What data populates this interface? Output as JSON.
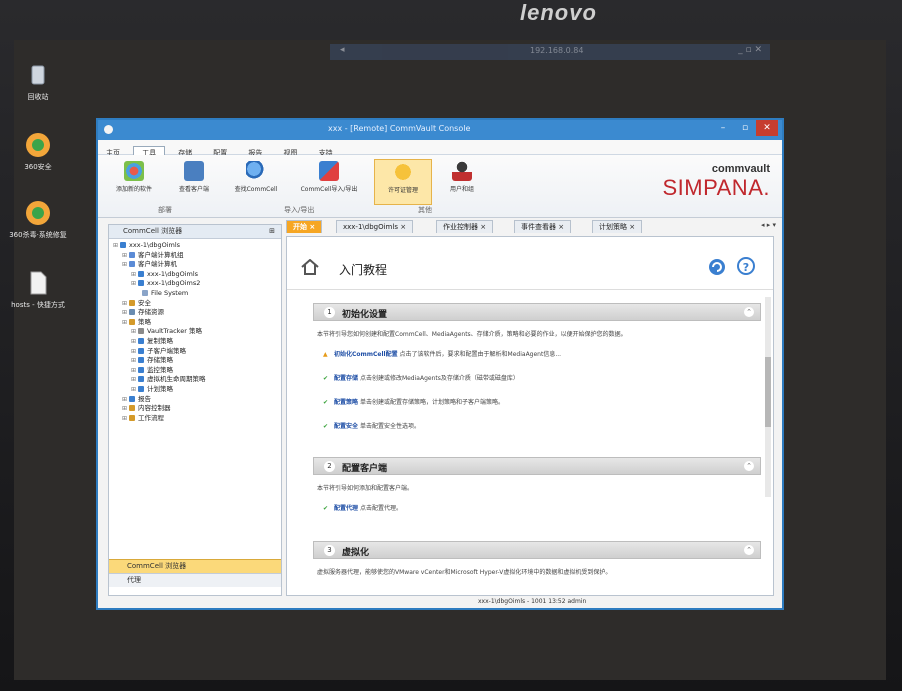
{
  "monitor": {
    "brand": "lenovo"
  },
  "ghost_window": {
    "title": "192.168.0.84",
    "arrow": "◂",
    "controls": "_ ▫ ✕"
  },
  "desktop": {
    "icons": [
      {
        "label": "回收站"
      },
      {
        "label": "360安全"
      },
      {
        "label": "360杀毒·系统修复"
      },
      {
        "label": "hosts - 快捷方式"
      }
    ]
  },
  "window": {
    "title": "xxx - [Remote] CommVault Console",
    "controls": {
      "minimize": "–",
      "maximize": "▫",
      "close": "✕"
    }
  },
  "menu": {
    "items": [
      "主页",
      "工具",
      "存储",
      "配置",
      "报告",
      "视图",
      "支持"
    ],
    "active_index": 1
  },
  "ribbon": {
    "buttons": [
      "添加新的软件",
      "查看客户端",
      "查找CommCell",
      "CommCell导入/导出",
      "许可证管理",
      "用户和组"
    ],
    "selected_index": 4,
    "groups": [
      "部署",
      "导入/导出",
      "其他"
    ]
  },
  "logo": {
    "line1": "commvault",
    "line2": "SIMPANA."
  },
  "left_panel": {
    "title": "CommCell 浏览器",
    "pin": "⊞",
    "tree": [
      {
        "label": "xxx-1\\dbgOimls",
        "depth": 0,
        "color": "#3a7fd0"
      },
      {
        "label": "客户端计算机组",
        "depth": 1,
        "color": "#5b8bd6"
      },
      {
        "label": "客户端计算机",
        "depth": 1,
        "color": "#5b8bd6"
      },
      {
        "label": "xxx-1\\dbgOimls",
        "depth": 2,
        "color": "#3a7fd0"
      },
      {
        "label": "xxx-1\\dbgOims2",
        "depth": 2,
        "color": "#3a7fd0"
      },
      {
        "label": "File System",
        "depth": 3,
        "color": "#8aa4c8"
      },
      {
        "label": "安全",
        "depth": 1,
        "color": "#d49a2a"
      },
      {
        "label": "存储资源",
        "depth": 1,
        "color": "#6a8cb0"
      },
      {
        "label": "策略",
        "depth": 1,
        "color": "#d49a2a"
      },
      {
        "label": "VaultTracker 策略",
        "depth": 2,
        "color": "#8a8a8a"
      },
      {
        "label": "复制策略",
        "depth": 2,
        "color": "#3a7fd0"
      },
      {
        "label": "子客户端策略",
        "depth": 2,
        "color": "#3a7fd0"
      },
      {
        "label": "存储策略",
        "depth": 2,
        "color": "#3a7fd0"
      },
      {
        "label": "监控策略",
        "depth": 2,
        "color": "#3a7fd0"
      },
      {
        "label": "虚拟机生命周期策略",
        "depth": 2,
        "color": "#3a7fd0"
      },
      {
        "label": "计划策略",
        "depth": 2,
        "color": "#3a7fd0"
      },
      {
        "label": "报告",
        "depth": 1,
        "color": "#3a7fd0"
      },
      {
        "label": "内容控制器",
        "depth": 1,
        "color": "#d49a2a"
      },
      {
        "label": "工作流程",
        "depth": 1,
        "color": "#d49a2a"
      }
    ],
    "footer": [
      "CommCell 浏览器",
      "代理"
    ]
  },
  "tabs": [
    {
      "label": "开始"
    },
    {
      "label": "xxx-1\\dbgOimls"
    },
    {
      "label": "作业控制器"
    },
    {
      "label": "事件查看器"
    },
    {
      "label": "计划策略"
    }
  ],
  "tab_nav": "◂ ▸ ▾",
  "content": {
    "title": "入门教程",
    "sections": [
      {
        "num": "1",
        "title": "初始化设置",
        "desc": "本节将引导您如何创建和配置CommCell、MediaAgents、存储介质，策略和必要的作业，以便开始保护您的数据。",
        "items": [
          {
            "status": "warn",
            "link": "初始化CommCell配置",
            "text": "点击了该软件后，要求和配置由于解析和MediaAgent信息..."
          },
          {
            "status": "ok",
            "link": "配置存储",
            "text": "点击创建或修改MediaAgents及存储介质（磁带或磁盘库）"
          },
          {
            "status": "ok",
            "link": "配置策略",
            "text": "单击创建或配置存储策略，计划策略和子客户端策略。"
          },
          {
            "status": "ok",
            "link": "配置安全",
            "text": "单击配置安全性选项。"
          }
        ]
      },
      {
        "num": "2",
        "title": "配置客户端",
        "desc": "本节将引导如何添加和配置客户端。",
        "items": [
          {
            "status": "ok",
            "link": "配置代理",
            "text": "点击配置代理。"
          }
        ]
      },
      {
        "num": "3",
        "title": "虚拟化",
        "desc": "虚拟服务器代理，能够使您的VMware vCenter和Microsoft Hyper-V虚拟化环境中的数据和虚拟机受到保护。",
        "items": []
      }
    ]
  },
  "statusbar": {
    "text": "xxx-1\\dbgOimls - 1001  13:52  admin"
  }
}
